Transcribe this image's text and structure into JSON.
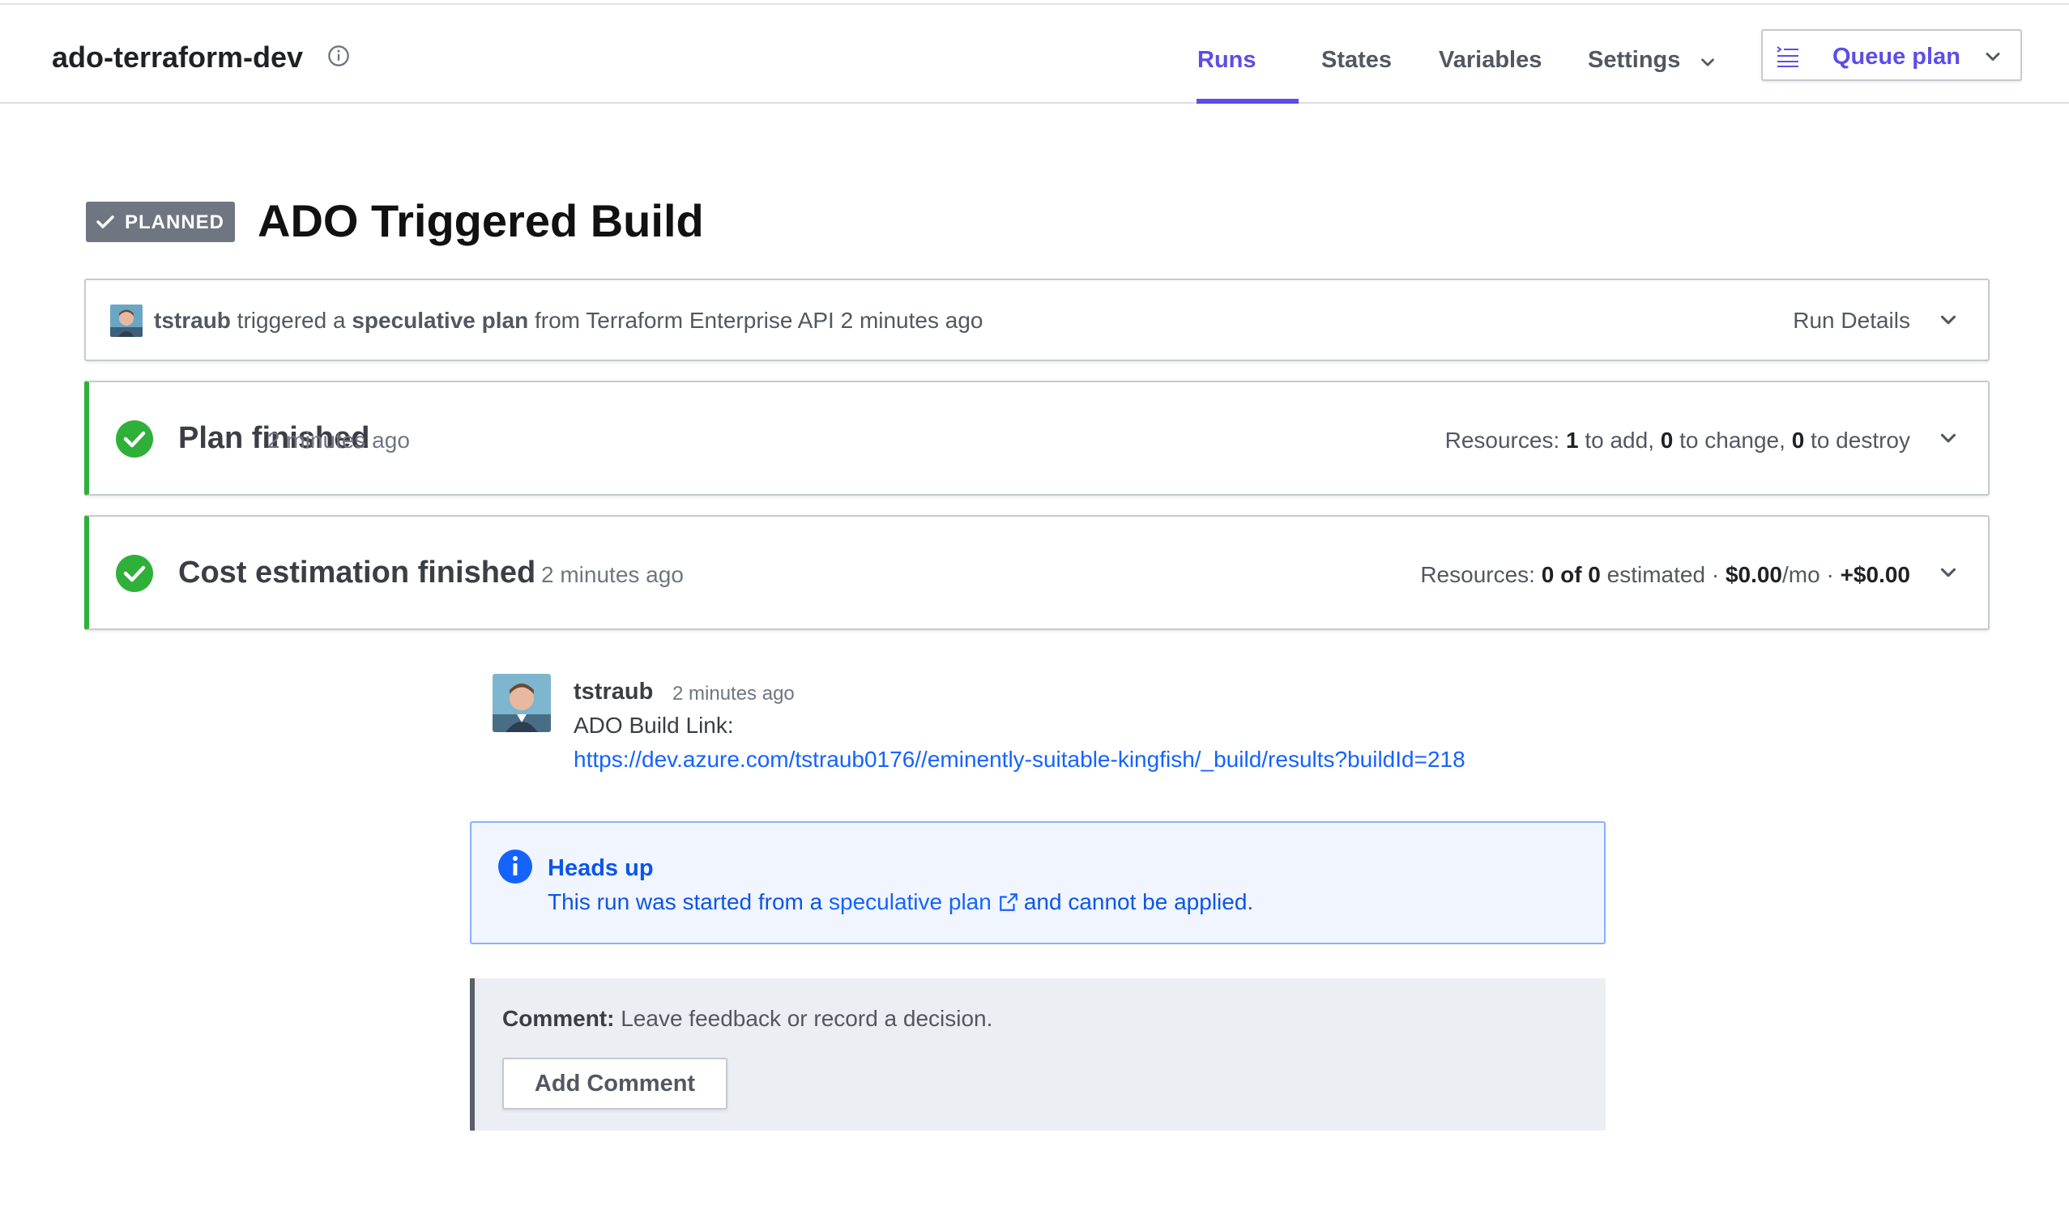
{
  "header": {
    "workspace_name": "ado-terraform-dev",
    "tabs": [
      {
        "label": "Runs",
        "active": true
      },
      {
        "label": "States"
      },
      {
        "label": "Variables"
      },
      {
        "label": "Settings"
      }
    ],
    "queue_plan_label": "Queue plan"
  },
  "run": {
    "status_badge": "PLANNED",
    "title": "ADO Triggered Build"
  },
  "trigger_card": {
    "user": "tstraub",
    "text_1": " triggered a ",
    "plan_type": "speculative plan",
    "text_2": " from Terraform Enterprise API 2 minutes ago",
    "run_details_label": "Run Details"
  },
  "plan_card": {
    "title": "Plan finished",
    "time": "2 minutes ago",
    "resources_label": "Resources: ",
    "add_count": "1",
    "add_text": " to add, ",
    "change_count": "0",
    "change_text": " to change, ",
    "destroy_count": "0",
    "destroy_text": " to destroy"
  },
  "cost_card": {
    "title": "Cost estimation finished",
    "time": "2 minutes ago",
    "resources_label": "Resources: ",
    "estimated_count": "0 of 0",
    "estimated_text": " estimated · ",
    "monthly_cost": "$0.00",
    "monthly_suffix": "/mo · ",
    "delta": "+$0.00"
  },
  "comment": {
    "author": "tstraub",
    "time": "2 minutes ago",
    "body": "ADO Build Link:",
    "link": "https://dev.azure.com/tstraub0176//eminently-suitable-kingfish/_build/results?buildId=218"
  },
  "alert": {
    "title": "Heads up",
    "text_before": "This run was started from a ",
    "link_text": "speculative plan",
    "text_after": "and cannot be applied."
  },
  "comment_box": {
    "label": "Comment:",
    "placeholder": " Leave feedback or record a decision.",
    "button_label": "Add Comment"
  },
  "colors": {
    "accent": "#5c4ee5",
    "success": "#2eb039",
    "link": "#1563ff",
    "badge": "#6f7682"
  },
  "icons": [
    "info-icon",
    "chevron-down-icon",
    "queue-plan-icon",
    "check-icon",
    "check-circle-icon",
    "info-circle-icon",
    "external-link-icon",
    "avatar"
  ]
}
